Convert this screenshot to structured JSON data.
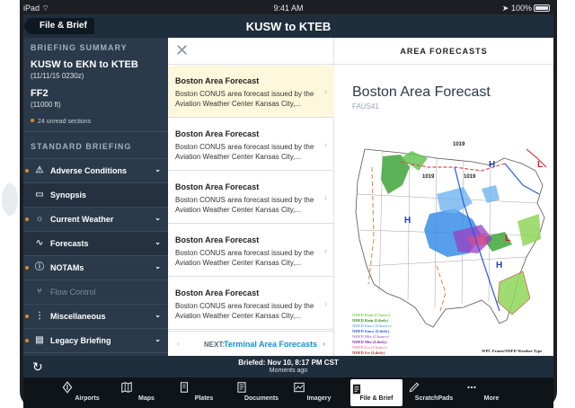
{
  "status_bar": {
    "device": "iPad",
    "time": "9:41 AM",
    "battery": "100%"
  },
  "header": {
    "back_label": "File & Brief",
    "title": "KUSW to KTEB"
  },
  "sidebar": {
    "briefing_summary_heading": "BRIEFING SUMMARY",
    "route": "KUSW to EKN to KTEB",
    "route_date": "(11/11/15 0230z)",
    "flight": "FF2",
    "altitude": "(11000 ft)",
    "unread": "24 unread sections",
    "standard_heading": "STANDARD BRIEFING",
    "items": [
      {
        "label": "Adverse Conditions",
        "icon": "warning-icon",
        "indicator": true,
        "chevron": true,
        "active": false,
        "disabled": false
      },
      {
        "label": "Synopsis",
        "icon": "synopsis-icon",
        "indicator": false,
        "chevron": false,
        "active": true,
        "disabled": false
      },
      {
        "label": "Current Weather",
        "icon": "weather-icon",
        "indicator": true,
        "chevron": true,
        "active": false,
        "disabled": false
      },
      {
        "label": "Forecasts",
        "icon": "forecast-icon",
        "indicator": false,
        "chevron": true,
        "active": true,
        "disabled": false
      },
      {
        "label": "NOTAMs",
        "icon": "info-icon",
        "indicator": true,
        "chevron": true,
        "active": false,
        "disabled": false
      },
      {
        "label": "Flow Control",
        "icon": "flow-icon",
        "indicator": false,
        "chevron": false,
        "active": false,
        "disabled": true
      },
      {
        "label": "Miscellaneous",
        "icon": "misc-icon",
        "indicator": true,
        "chevron": true,
        "active": false,
        "disabled": false
      },
      {
        "label": "Legacy Briefing",
        "icon": "legacy-icon",
        "indicator": true,
        "chevron": true,
        "active": false,
        "disabled": false
      }
    ]
  },
  "forecast_list": {
    "items": [
      {
        "title": "Boston Area Forecast",
        "desc": "Boston CONUS area forecast issued by the Aviation Weather Center Kansas City,..."
      },
      {
        "title": "Boston Area Forecast",
        "desc": "Boston CONUS area forecast issued by the Aviation Weather Center Kansas City,..."
      },
      {
        "title": "Boston Area Forecast",
        "desc": "Boston CONUS area forecast issued by the Aviation Weather Center Kansas City,..."
      },
      {
        "title": "Boston Area Forecast",
        "desc": "Boston CONUS area forecast issued by the Aviation Weather Center Kansas City,..."
      },
      {
        "title": "Boston Area Forecast",
        "desc": "Boston CONUS area forecast issued by the Aviation Weather Center Kansas City,..."
      }
    ],
    "next_label": "NEXT:",
    "next_target": "Terminal Area Forecasts"
  },
  "detail": {
    "heading": "AREA FORECASTS",
    "title": "Boston Area Forecast",
    "code": "FAUS41",
    "map": {
      "pressure_labels": [
        "1019",
        "1019",
        "1019",
        "H",
        "H",
        "H",
        "L",
        "L"
      ],
      "legend": [
        "NDFD Rain (Chance)",
        "NDFD Rain (Likely)",
        "NDFD Snow (Chance)",
        "NDFD Snow (Likely)",
        "NDFD Mix (Chance)",
        "NDFD Mix (Likely)",
        "NDFD Ice (Chance)",
        "NDFD Ice (Likely)"
      ],
      "credit": "WPC Fronts/NDFD Weather Type"
    }
  },
  "footer": {
    "briefed": "Briefed: Nov 10, 8:17 PM CST",
    "ago": "Moments ago"
  },
  "tabs": [
    {
      "label": "Airports",
      "icon": "airport-icon"
    },
    {
      "label": "Maps",
      "icon": "map-icon"
    },
    {
      "label": "Plates",
      "icon": "plates-icon"
    },
    {
      "label": "Documents",
      "icon": "documents-icon"
    },
    {
      "label": "Imagery",
      "icon": "imagery-icon"
    },
    {
      "label": "File & Brief",
      "icon": "file-brief-icon",
      "active": true
    },
    {
      "label": "ScratchPads",
      "icon": "scratchpad-icon"
    },
    {
      "label": "More",
      "icon": "more-icon"
    }
  ]
}
